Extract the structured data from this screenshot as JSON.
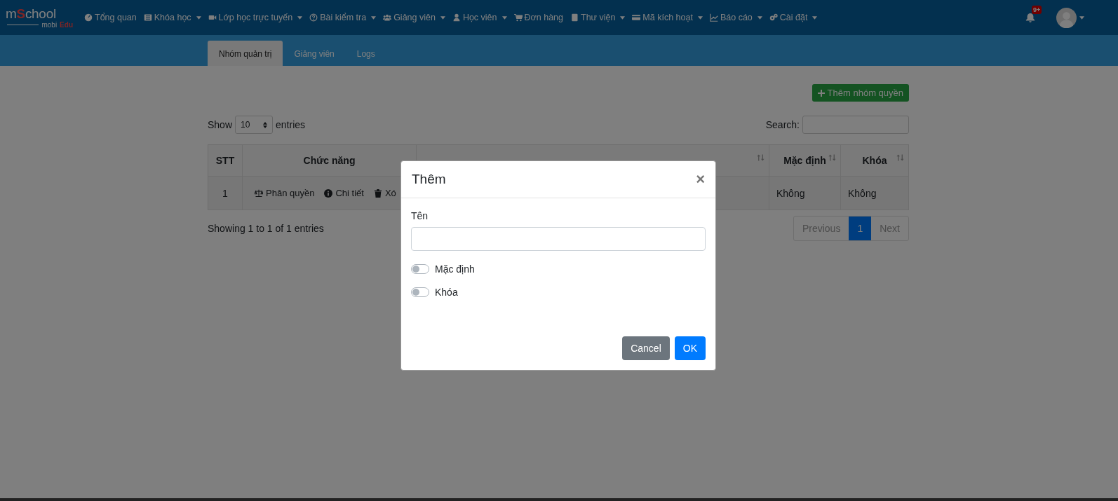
{
  "navbar": {
    "logo": {
      "prefix": "m",
      "highlight": "S",
      "suffix": "chool",
      "sub_prefix": "mobi",
      "sub_highlight": "Edu"
    },
    "menu": [
      {
        "label": "Tổng quan",
        "dropdown": false
      },
      {
        "label": "Khóa học",
        "dropdown": true
      },
      {
        "label": "Lớp học trực tuyến",
        "dropdown": true
      },
      {
        "label": "Bài kiểm tra",
        "dropdown": true
      },
      {
        "label": "Giảng viên",
        "dropdown": true
      },
      {
        "label": "Học viên",
        "dropdown": true
      },
      {
        "label": "Đơn hàng",
        "dropdown": false
      },
      {
        "label": "Thư viện",
        "dropdown": true
      },
      {
        "label": "Mã kích hoạt",
        "dropdown": true
      },
      {
        "label": "Báo cáo",
        "dropdown": true
      },
      {
        "label": "Cài đặt",
        "dropdown": true
      }
    ],
    "notification_badge": "9+"
  },
  "tabs": [
    {
      "label": "Nhóm quản trị",
      "selected": true
    },
    {
      "label": "Giảng viên",
      "selected": false
    },
    {
      "label": "Logs",
      "selected": false
    }
  ],
  "add_button": "Thêm nhóm quyền",
  "length": {
    "show": "Show",
    "value": "10",
    "entries": "entries"
  },
  "search": {
    "label": "Search:"
  },
  "table": {
    "columns": [
      {
        "label": "STT",
        "sortable": false
      },
      {
        "label": "Chức năng",
        "sortable": false
      },
      {
        "sortable": true
      },
      {
        "label": "Mặc định",
        "sortable": true
      },
      {
        "label": "Khóa",
        "sortable": true
      }
    ],
    "rows": [
      {
        "stt": "1",
        "actions": [
          "Phân quyền",
          "Chi tiết",
          "Xó"
        ],
        "default": "Không",
        "locked": "Không"
      }
    ]
  },
  "info": "Showing 1 to 1 of 1 entries",
  "pagination": [
    {
      "label": "Previous",
      "selected": false
    },
    {
      "label": "1",
      "selected": true
    },
    {
      "label": "Next",
      "selected": false
    }
  ],
  "modal": {
    "title": "Thêm",
    "close": "×",
    "field_label": "Tên",
    "toggles": [
      {
        "label": "Mặc định",
        "checked": false
      },
      {
        "label": "Khóa",
        "checked": false
      }
    ],
    "cancel": "Cancel",
    "ok": "OK"
  }
}
